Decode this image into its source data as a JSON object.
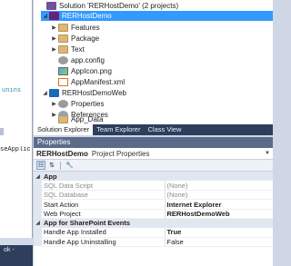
{
  "editor": {
    "fragment1": "unins",
    "fragment2": "seApplic",
    "bottom_fragment": "ok -"
  },
  "solution_explorer": {
    "solution_label": "Solution 'RERHostDemo' (2 projects)",
    "items": [
      {
        "label": "RERHostDemo",
        "icon": "sharepoint-project-icon"
      },
      {
        "label": "Features",
        "icon": "folder-icon"
      },
      {
        "label": "Package",
        "icon": "folder-icon"
      },
      {
        "label": "Text",
        "icon": "folder-icon"
      },
      {
        "label": "app.config",
        "icon": "config-file-icon"
      },
      {
        "label": "AppIcon.png",
        "icon": "image-file-icon"
      },
      {
        "label": "AppManifest.xml",
        "icon": "xml-file-icon"
      },
      {
        "label": "RERHostDemoWeb",
        "icon": "web-project-icon"
      },
      {
        "label": "Properties",
        "icon": "properties-icon"
      },
      {
        "label": "References",
        "icon": "references-icon"
      },
      {
        "label": "App_Data",
        "icon": "folder-icon"
      }
    ]
  },
  "tabs": [
    "Solution Explorer",
    "Team Explorer",
    "Class View"
  ],
  "properties": {
    "title": "Properties",
    "object_name": "RERHostDemo",
    "object_type": "Project Properties",
    "categories": [
      {
        "name": "App",
        "rows": [
          {
            "name": "SQL Data Script",
            "value": "(None)",
            "disabled": true
          },
          {
            "name": "SQL Database",
            "value": "(None)",
            "disabled": true
          },
          {
            "name": "Start Action",
            "value": "Internet Explorer",
            "bold": true
          },
          {
            "name": "Web Project",
            "value": "RERHostDemoWeb",
            "bold": true
          }
        ]
      },
      {
        "name": "App for SharePoint Events",
        "rows": [
          {
            "name": "Handle App Installed",
            "value": "True",
            "bold": true
          },
          {
            "name": "Handle App Uninstalling",
            "value": "False"
          }
        ]
      }
    ]
  },
  "colors": {
    "selection": "#3399ff",
    "tab_strip": "#2d3f5c",
    "header": "#5b6b8a"
  }
}
